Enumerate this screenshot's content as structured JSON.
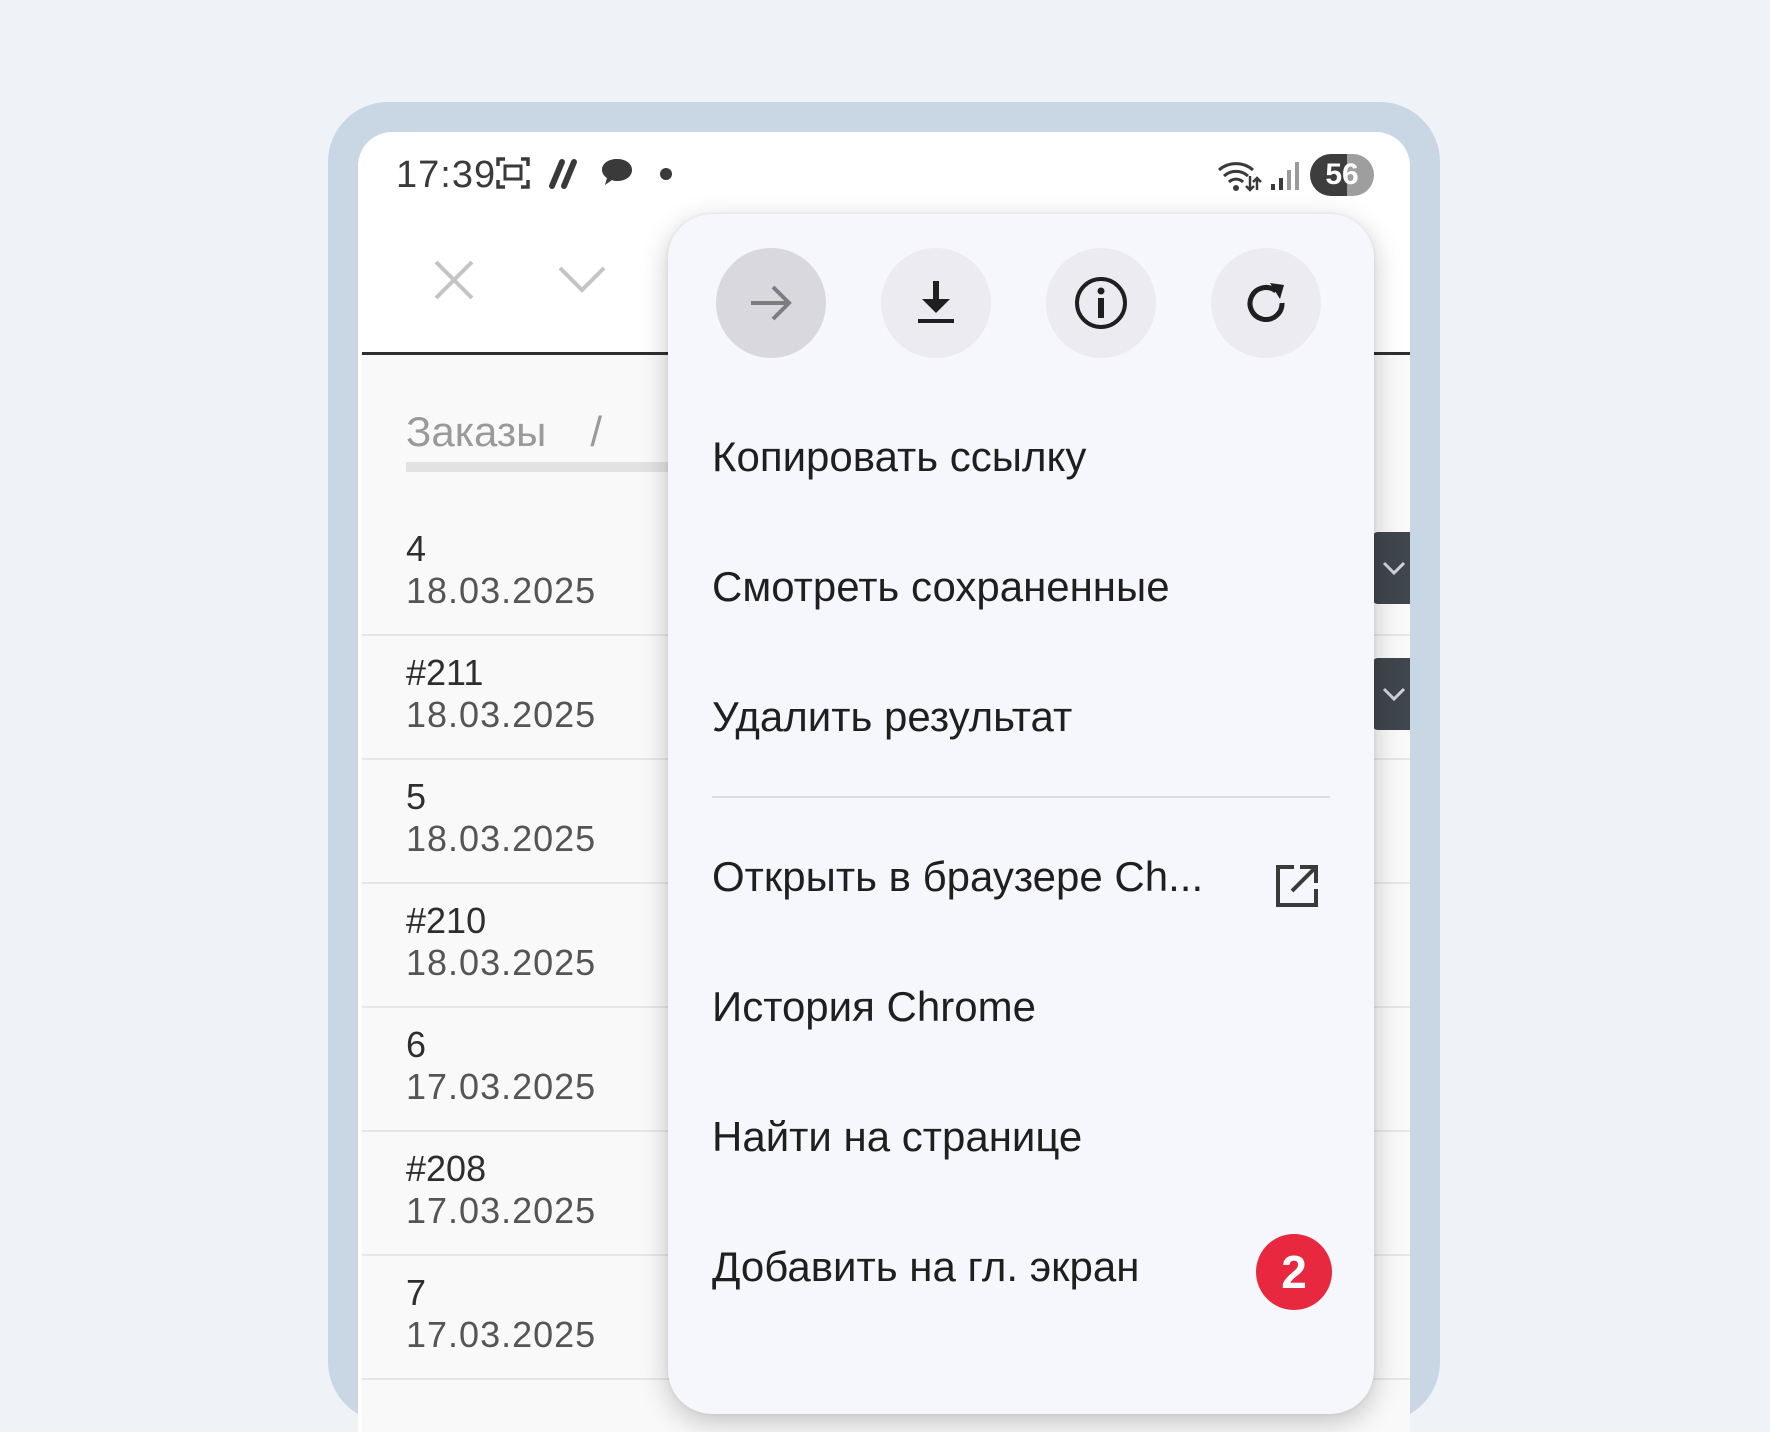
{
  "status_bar": {
    "time": "17:39",
    "battery": "56",
    "icons": [
      "screenshot-icon",
      "slashes-icon",
      "chat-bubble-icon",
      "dot-icon",
      "wifi-icon",
      "signal-icon"
    ]
  },
  "toolbar": {
    "icons": [
      "close-icon",
      "chevron-down-icon"
    ]
  },
  "breadcrumb": {
    "item": "Заказы",
    "separator": "/"
  },
  "orders": [
    {
      "number": "4",
      "date": "18.03.2025"
    },
    {
      "number": "#211",
      "date": "18.03.2025"
    },
    {
      "number": "5",
      "date": "18.03.2025"
    },
    {
      "number": "#210",
      "date": "18.03.2025"
    },
    {
      "number": "6",
      "date": "17.03.2025"
    },
    {
      "number": "#208",
      "date": "17.03.2025"
    },
    {
      "number": "7",
      "date": "17.03.2025"
    }
  ],
  "menu": {
    "top_icons": [
      "forward-arrow-icon",
      "download-icon",
      "info-icon",
      "refresh-icon"
    ],
    "items": [
      {
        "label": "Копировать ссылку"
      },
      {
        "label": "Смотреть сохраненные"
      },
      {
        "label": "Удалить результат"
      },
      {
        "label": "Открыть в браузере Ch...",
        "icon": "open-external-icon"
      },
      {
        "label": "История Chrome"
      },
      {
        "label": "Найти на странице"
      },
      {
        "label": "Добавить на гл. экран"
      }
    ]
  },
  "badge": {
    "value": "2",
    "color": "#e8283e"
  }
}
